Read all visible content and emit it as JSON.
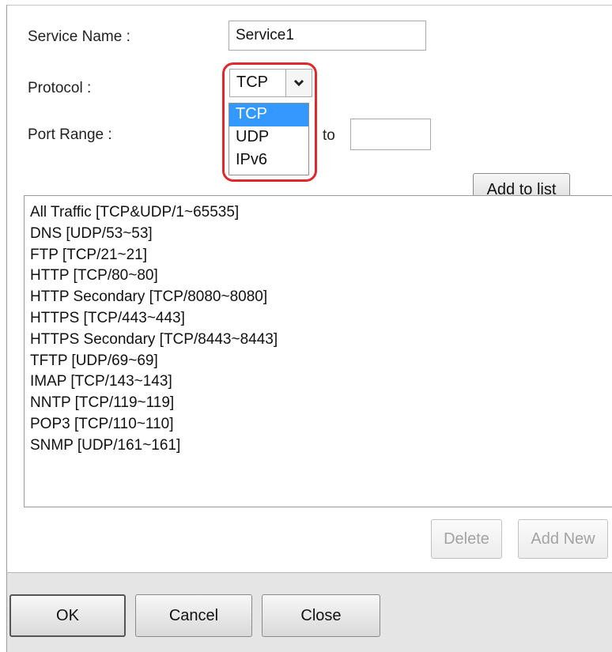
{
  "form": {
    "service_name_label": "Service Name :",
    "service_name_value": "Service1",
    "protocol_label": "Protocol :",
    "protocol_selected": "TCP",
    "protocol_options": [
      "TCP",
      "UDP",
      "IPv6"
    ],
    "port_range_label": "Port Range :",
    "port_range_to_label": "to",
    "port_range_start": "",
    "port_range_end": "",
    "add_to_list_label": "Add to list"
  },
  "services": [
    "All Traffic [TCP&UDP/1~65535]",
    "DNS [UDP/53~53]",
    "FTP [TCP/21~21]",
    "HTTP [TCP/80~80]",
    "HTTP Secondary [TCP/8080~8080]",
    "HTTPS [TCP/443~443]",
    "HTTPS Secondary [TCP/8443~8443]",
    "TFTP [UDP/69~69]",
    "IMAP [TCP/143~143]",
    "NNTP [TCP/119~119]",
    "POP3 [TCP/110~110]",
    "SNMP [UDP/161~161]"
  ],
  "list_actions": {
    "delete_label": "Delete",
    "add_new_label": "Add New"
  },
  "footer": {
    "ok_label": "OK",
    "cancel_label": "Cancel",
    "close_label": "Close"
  },
  "colors": {
    "highlight": "#e0282d",
    "selected_option": "#3399ff",
    "footer_bg": "#e5e5e5"
  },
  "icons": {
    "dropdown_arrow": "chevron-down-icon"
  }
}
